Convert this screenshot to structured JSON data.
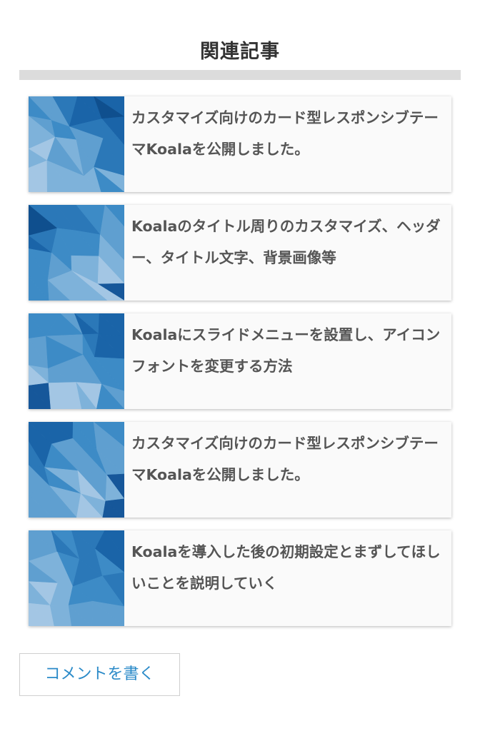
{
  "section": {
    "title": "関連記事"
  },
  "related_articles": [
    {
      "title": "カスタマイズ向けのカード型レスポンシブテーマKoalaを公開しました。",
      "thumbnail": "blue-polygon-thumbnail"
    },
    {
      "title": "Koalaのタイトル周りのカスタマイズ、ヘッダー、タイトル文字、背景画像等",
      "thumbnail": "blue-polygon-thumbnail"
    },
    {
      "title": "Koalaにスライドメニューを設置し、アイコンフォントを変更する方法",
      "thumbnail": "blue-polygon-thumbnail"
    },
    {
      "title": "カスタマイズ向けのカード型レスポンシブテーマKoalaを公開しました。",
      "thumbnail": "blue-polygon-thumbnail"
    },
    {
      "title": "Koalaを導入した後の初期設定とまずしてほしいことを説明していく",
      "thumbnail": "blue-polygon-thumbnail"
    }
  ],
  "comment": {
    "button_label": "コメントを書く"
  },
  "colors": {
    "accent": "#2a8ac8",
    "title_text": "#333333",
    "card_text": "#555555",
    "rule": "#dcdcdc"
  }
}
